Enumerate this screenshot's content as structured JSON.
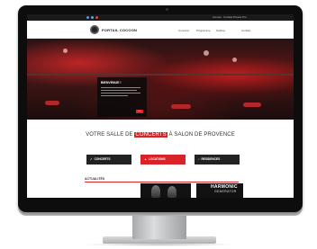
{
  "site": {
    "logo_text": "PORTAIL COCOON",
    "top_links": [
      "Accueil",
      "Contact",
      "Presse",
      "Pro"
    ],
    "nav": [
      "Concerts",
      "Programme",
      "Studios",
      "Contact"
    ]
  },
  "hero": {
    "box_title": "BIENVENUE !",
    "button": "Lire"
  },
  "headline": {
    "before": "VOTRE SALLE DE",
    "highlight": "CONCERTS",
    "after": "À SALON DE PROVENCE"
  },
  "tiles": [
    {
      "label": "CONCERTS",
      "icon": "ticket-icon",
      "color": "#222222"
    },
    {
      "label": "LOCATIONS",
      "icon": "key-icon",
      "color": "#d8232a"
    },
    {
      "label": "RESIDENCES",
      "icon": "music-icon",
      "color": "#222222"
    }
  ],
  "news": {
    "title": "ACTUALITÉS",
    "promo_line1": "HARMONIC",
    "promo_line2": "GENERATOR"
  },
  "colors": {
    "accent": "#d8232a",
    "dark": "#222222"
  }
}
